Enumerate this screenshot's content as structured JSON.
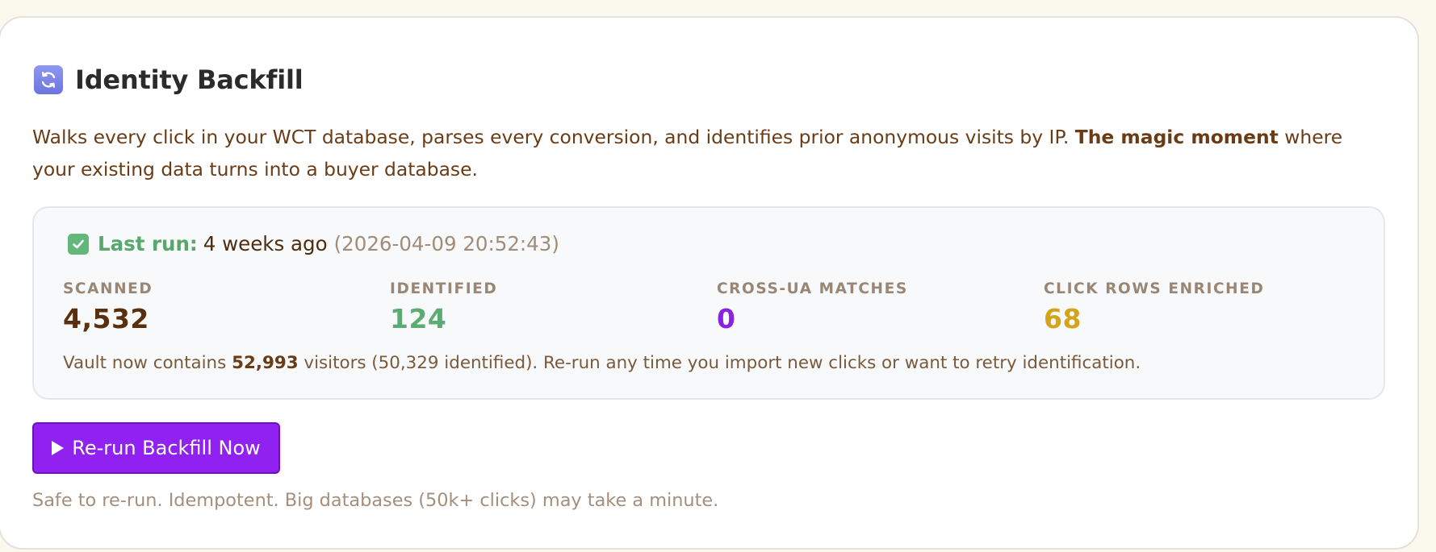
{
  "header": {
    "icon": "refresh-icon",
    "title": "Identity Backfill"
  },
  "description": {
    "before": "Walks every click in your WCT database, parses every conversion, and identifies prior anonymous visits by IP. ",
    "bold": "The magic moment",
    "after": " where your existing data turns into a buyer database."
  },
  "last_run": {
    "icon": "check-icon",
    "label": "Last run:",
    "relative": "4 weeks ago",
    "timestamp": "(2026-04-09 20:52:43)"
  },
  "stats": [
    {
      "label": "SCANNED",
      "value": "4,532",
      "color": "#5a2f0e"
    },
    {
      "label": "IDENTIFIED",
      "value": "124",
      "color": "#5aac72"
    },
    {
      "label": "CROSS-UA MATCHES",
      "value": "0",
      "color": "#8a22e0"
    },
    {
      "label": "CLICK ROWS ENRICHED",
      "value": "68",
      "color": "#d4a51a"
    }
  ],
  "summary": {
    "before": "Vault now contains ",
    "bold": "52,993",
    "after": " visitors (50,329 identified). Re-run any time you import new clicks or want to retry identification."
  },
  "button": {
    "icon": "play-icon",
    "label": "Re-run Backfill Now",
    "color": "#9121f0"
  },
  "note": "Safe to re-run. Idempotent. Big databases (50k+ clicks) may take a minute."
}
